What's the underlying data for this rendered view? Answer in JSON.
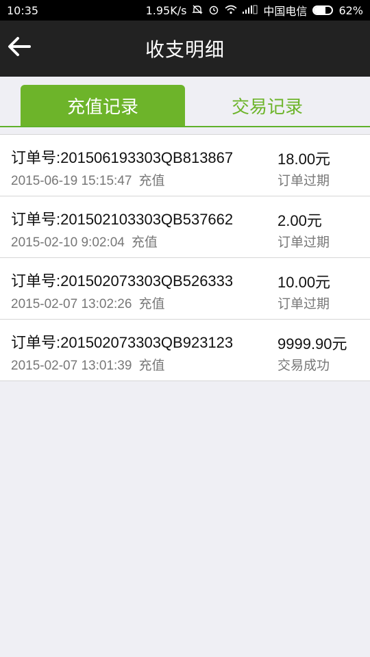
{
  "status_bar": {
    "time": "10:35",
    "speed": "1.95K/s",
    "carrier": "中国电信",
    "battery": "62%",
    "battery_level": 0.62,
    "icons": [
      "mute-icon",
      "alarm-icon",
      "wifi-icon",
      "signal-icon",
      "battery-icon"
    ]
  },
  "app_bar": {
    "title": "收支明细",
    "back_icon": "back-arrow-icon"
  },
  "tabs": [
    {
      "label": "充值记录",
      "active": true
    },
    {
      "label": "交易记录",
      "active": false
    }
  ],
  "colors": {
    "accent": "#6db42a",
    "app_bar_bg": "#222222",
    "page_bg": "#efeff4"
  },
  "records": [
    {
      "order": "订单号:201506193303QB813867",
      "date": "2015-06-19 15:15:47",
      "type": "充值",
      "amount": "18.00元",
      "status": "订单过期"
    },
    {
      "order": "订单号:201502103303QB537662",
      "date": "2015-02-10 9:02:04",
      "type": "充值",
      "amount": "2.00元",
      "status": "订单过期"
    },
    {
      "order": "订单号:201502073303QB526333",
      "date": "2015-02-07 13:02:26",
      "type": "充值",
      "amount": "10.00元",
      "status": "订单过期"
    },
    {
      "order": "订单号:201502073303QB923123",
      "date": "2015-02-07 13:01:39",
      "type": "充值",
      "amount": "9999.90元",
      "status": "交易成功"
    }
  ]
}
